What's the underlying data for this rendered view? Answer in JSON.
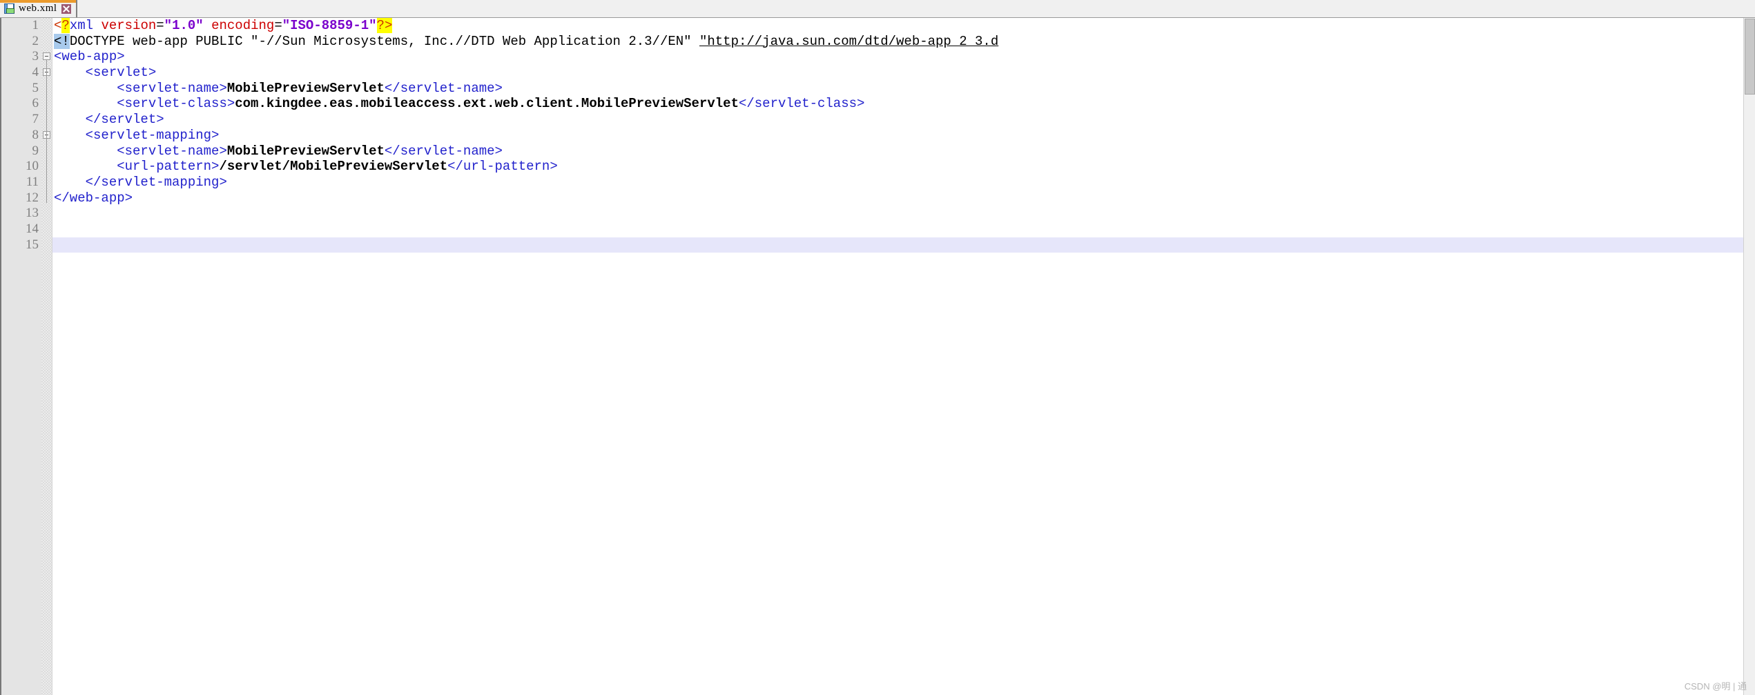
{
  "window": {
    "title": "web.xml",
    "accent_color": "#eb9b2d"
  },
  "tab": {
    "label": "web.xml",
    "save_icon": "floppy-disk-icon",
    "close_icon": "close-icon"
  },
  "editor": {
    "language": "xml",
    "current_line": 15,
    "current_line_color": "#e6e6fa",
    "gutter_bg": "#e4e4e4",
    "line_numbers": [
      "1",
      "2",
      "3",
      "4",
      "5",
      "6",
      "7",
      "8",
      "9",
      "10",
      "11",
      "12",
      "13",
      "14",
      "15"
    ],
    "colors": {
      "punct": "#cc3300",
      "tag": "#2222cc",
      "attribute": "#cc0000",
      "value": "#7a00cc",
      "text": "#000000",
      "highlight_yellow": "#ffff00",
      "highlight_blue": "#a8caec"
    },
    "lines": [
      {
        "number": 1,
        "fold": "none",
        "tokens": [
          {
            "t": "<",
            "k": "punct"
          },
          {
            "t": "?",
            "k": "punct",
            "hl": "yellow"
          },
          {
            "t": "xml",
            "k": "tag"
          },
          {
            "t": " ",
            "k": "plain"
          },
          {
            "t": "version",
            "k": "attr"
          },
          {
            "t": "=",
            "k": "eq"
          },
          {
            "t": "\"1.0\"",
            "k": "val"
          },
          {
            "t": " ",
            "k": "plain"
          },
          {
            "t": "encoding",
            "k": "attr"
          },
          {
            "t": "=",
            "k": "eq"
          },
          {
            "t": "\"ISO-8859-1\"",
            "k": "val"
          },
          {
            "t": "?>",
            "k": "punct",
            "hl": "yellow"
          }
        ]
      },
      {
        "number": 2,
        "fold": "none",
        "tokens": [
          {
            "t": "<!",
            "k": "plain",
            "hl": "blue"
          },
          {
            "t": "DOCTYPE web-app PUBLIC \"-//Sun Microsystems, Inc.//DTD Web Application 2.3//EN\" ",
            "k": "plain"
          },
          {
            "t": "\"http://java.sun.com/dtd/web-app_2_3.d",
            "k": "link"
          }
        ]
      },
      {
        "number": 3,
        "fold": "open-start",
        "tokens": [
          {
            "t": "<web-app>",
            "k": "tag"
          }
        ]
      },
      {
        "number": 4,
        "fold": "open",
        "tokens": [
          {
            "t": "    ",
            "k": "plain"
          },
          {
            "t": "<servlet>",
            "k": "tag"
          }
        ]
      },
      {
        "number": 5,
        "fold": "line",
        "tokens": [
          {
            "t": "        ",
            "k": "plain"
          },
          {
            "t": "<servlet-name>",
            "k": "tag"
          },
          {
            "t": "MobilePreviewServlet",
            "k": "text"
          },
          {
            "t": "</servlet-name>",
            "k": "tag"
          }
        ]
      },
      {
        "number": 6,
        "fold": "line",
        "tokens": [
          {
            "t": "        ",
            "k": "plain"
          },
          {
            "t": "<servlet-class>",
            "k": "tag"
          },
          {
            "t": "com.kingdee.eas.mobileaccess.ext.web.client.MobilePreviewServlet",
            "k": "text"
          },
          {
            "t": "</servlet-class>",
            "k": "tag"
          }
        ]
      },
      {
        "number": 7,
        "fold": "line-end",
        "tokens": [
          {
            "t": "    ",
            "k": "plain"
          },
          {
            "t": "</servlet>",
            "k": "tag"
          }
        ]
      },
      {
        "number": 8,
        "fold": "open",
        "tokens": [
          {
            "t": "    ",
            "k": "plain"
          },
          {
            "t": "<servlet-mapping>",
            "k": "tag"
          }
        ]
      },
      {
        "number": 9,
        "fold": "line",
        "tokens": [
          {
            "t": "        ",
            "k": "plain"
          },
          {
            "t": "<servlet-name>",
            "k": "tag"
          },
          {
            "t": "MobilePreviewServlet",
            "k": "text"
          },
          {
            "t": "</servlet-name>",
            "k": "tag"
          }
        ]
      },
      {
        "number": 10,
        "fold": "line",
        "tokens": [
          {
            "t": "        ",
            "k": "plain"
          },
          {
            "t": "<url-pattern>",
            "k": "tag"
          },
          {
            "t": "/servlet/MobilePreviewServlet",
            "k": "text"
          },
          {
            "t": "</url-pattern>",
            "k": "tag"
          }
        ]
      },
      {
        "number": 11,
        "fold": "line-end",
        "tokens": [
          {
            "t": "    ",
            "k": "plain"
          },
          {
            "t": "</servlet-mapping>",
            "k": "tag"
          }
        ]
      },
      {
        "number": 12,
        "fold": "close-end",
        "tokens": [
          {
            "t": "</web-app>",
            "k": "tag"
          }
        ]
      },
      {
        "number": 13,
        "fold": "none",
        "tokens": []
      },
      {
        "number": 14,
        "fold": "none",
        "tokens": []
      },
      {
        "number": 15,
        "fold": "none",
        "tokens": [],
        "current": true
      }
    ]
  },
  "watermark": {
    "text": "CSDN @明 | 通"
  }
}
